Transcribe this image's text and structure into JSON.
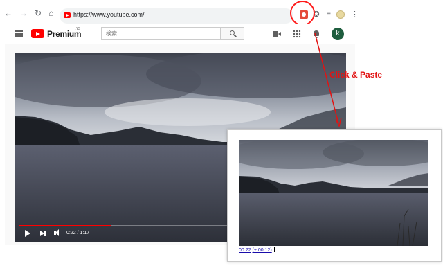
{
  "browser": {
    "url": "https://www.youtube.com/",
    "icons": [
      "back-icon",
      "forward-icon",
      "reload-icon",
      "home-icon",
      "youtube-favicon",
      "extension-icon",
      "puzzle-icon",
      "media-queue-icon",
      "profile-avatar",
      "more-vert-icon"
    ]
  },
  "youtube": {
    "logo_text": "Premium",
    "logo_region": "JP",
    "search_placeholder": "検索",
    "avatar_letter": "k"
  },
  "player": {
    "time_display": "0:22 / 1:17",
    "progress_fraction": 0.285
  },
  "popup": {
    "time_link": "00:22",
    "offset_link": "(+ 00:12)"
  },
  "annotation": {
    "label": "Click & Paste",
    "color": "#e21313"
  },
  "colors": {
    "youtube_red": "#ff0000",
    "link_blue": "#1a0dab",
    "annotation_red": "#e21313"
  }
}
